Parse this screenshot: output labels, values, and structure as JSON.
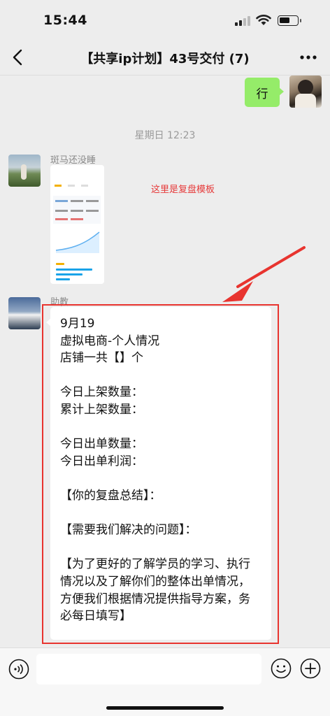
{
  "status_bar": {
    "time": "15:44"
  },
  "nav": {
    "title": "【共享ip计划】43号交付 (7)"
  },
  "messages": {
    "my_message": "行",
    "timestamp": "星期日 12:23",
    "zebra": {
      "sender": "斑马还没睡"
    },
    "note": "这里是复盘模板",
    "assistant": {
      "sender": "助教",
      "text": "9月19\n虚拟电商-个人情况\n店铺一共【】个\n\n今日上架数量：\n累计上架数量：\n\n今日出单数量：\n今日出单利润：\n\n【你的复盘总结】：\n\n【需要我们解决的问题】：\n\n【为了更好的了解学员的学习、执行情况以及了解你们的整体出单情况，方便我们根据情况提供指导方案，务必每日填写】"
    }
  },
  "colors": {
    "accent_red": "#e8342f",
    "bubble_green": "#95ec69",
    "background": "#ededed"
  },
  "icons": [
    "back-icon",
    "more-icon",
    "voice-icon",
    "emoji-icon",
    "plus-icon"
  ]
}
